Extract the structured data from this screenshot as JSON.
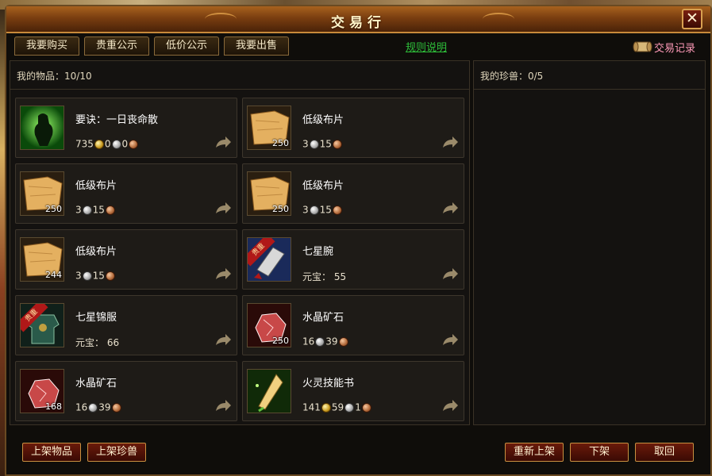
{
  "window": {
    "title": "交易行",
    "close_label": "✕"
  },
  "tabs": [
    {
      "label": "我要购买"
    },
    {
      "label": "贵重公示"
    },
    {
      "label": "低价公示"
    },
    {
      "label": "我要出售"
    }
  ],
  "rules_link": "规则说明",
  "trade_log": {
    "label": "交易记录",
    "icon": "scroll-icon"
  },
  "left_panel": {
    "header": "我的物品：10/10"
  },
  "right_panel": {
    "header": "我的珍兽：0/5"
  },
  "items": [
    {
      "name": "要诀：一日丧命散",
      "icon": "skill-book-green",
      "qty": "",
      "precious": false,
      "price": {
        "gold": "735",
        "silver": "0",
        "copper": "0"
      }
    },
    {
      "name": "低级布片",
      "icon": "cloth-piece",
      "qty": "250",
      "precious": false,
      "price": {
        "silver": "3",
        "copper": "15"
      }
    },
    {
      "name": "低级布片",
      "icon": "cloth-piece",
      "qty": "250",
      "precious": false,
      "price": {
        "silver": "3",
        "copper": "15"
      }
    },
    {
      "name": "低级布片",
      "icon": "cloth-piece",
      "qty": "250",
      "precious": false,
      "price": {
        "silver": "3",
        "copper": "15"
      }
    },
    {
      "name": "低级布片",
      "icon": "cloth-piece",
      "qty": "244",
      "precious": false,
      "price": {
        "silver": "3",
        "copper": "15"
      }
    },
    {
      "name": "七星腕",
      "icon": "bracer",
      "qty": "",
      "precious": true,
      "precious_label": "贵重",
      "price": {
        "yuanbao_label": "元宝：",
        "yuanbao": "55"
      }
    },
    {
      "name": "七星锦服",
      "icon": "armor",
      "qty": "",
      "precious": true,
      "precious_label": "贵重",
      "price": {
        "yuanbao_label": "元宝：",
        "yuanbao": "66"
      }
    },
    {
      "name": "水晶矿石",
      "icon": "crystal-ore",
      "qty": "250",
      "precious": false,
      "price": {
        "silver": "16",
        "copper": "39"
      }
    },
    {
      "name": "水晶矿石",
      "icon": "crystal-ore",
      "qty": "168",
      "precious": false,
      "price": {
        "silver": "16",
        "copper": "39"
      }
    },
    {
      "name": "火灵技能书",
      "icon": "fire-skill-book",
      "qty": "",
      "precious": false,
      "price": {
        "gold": "141",
        "silver": "59",
        "copper": "1"
      }
    }
  ],
  "bottom_buttons": {
    "list_item": "上架物品",
    "list_pet": "上架珍兽",
    "relist": "重新上架",
    "delist": "下架",
    "retrieve": "取回"
  },
  "colors": {
    "accent": "#c89040",
    "link": "#2ec03a",
    "log_label": "#ff9ab8"
  }
}
